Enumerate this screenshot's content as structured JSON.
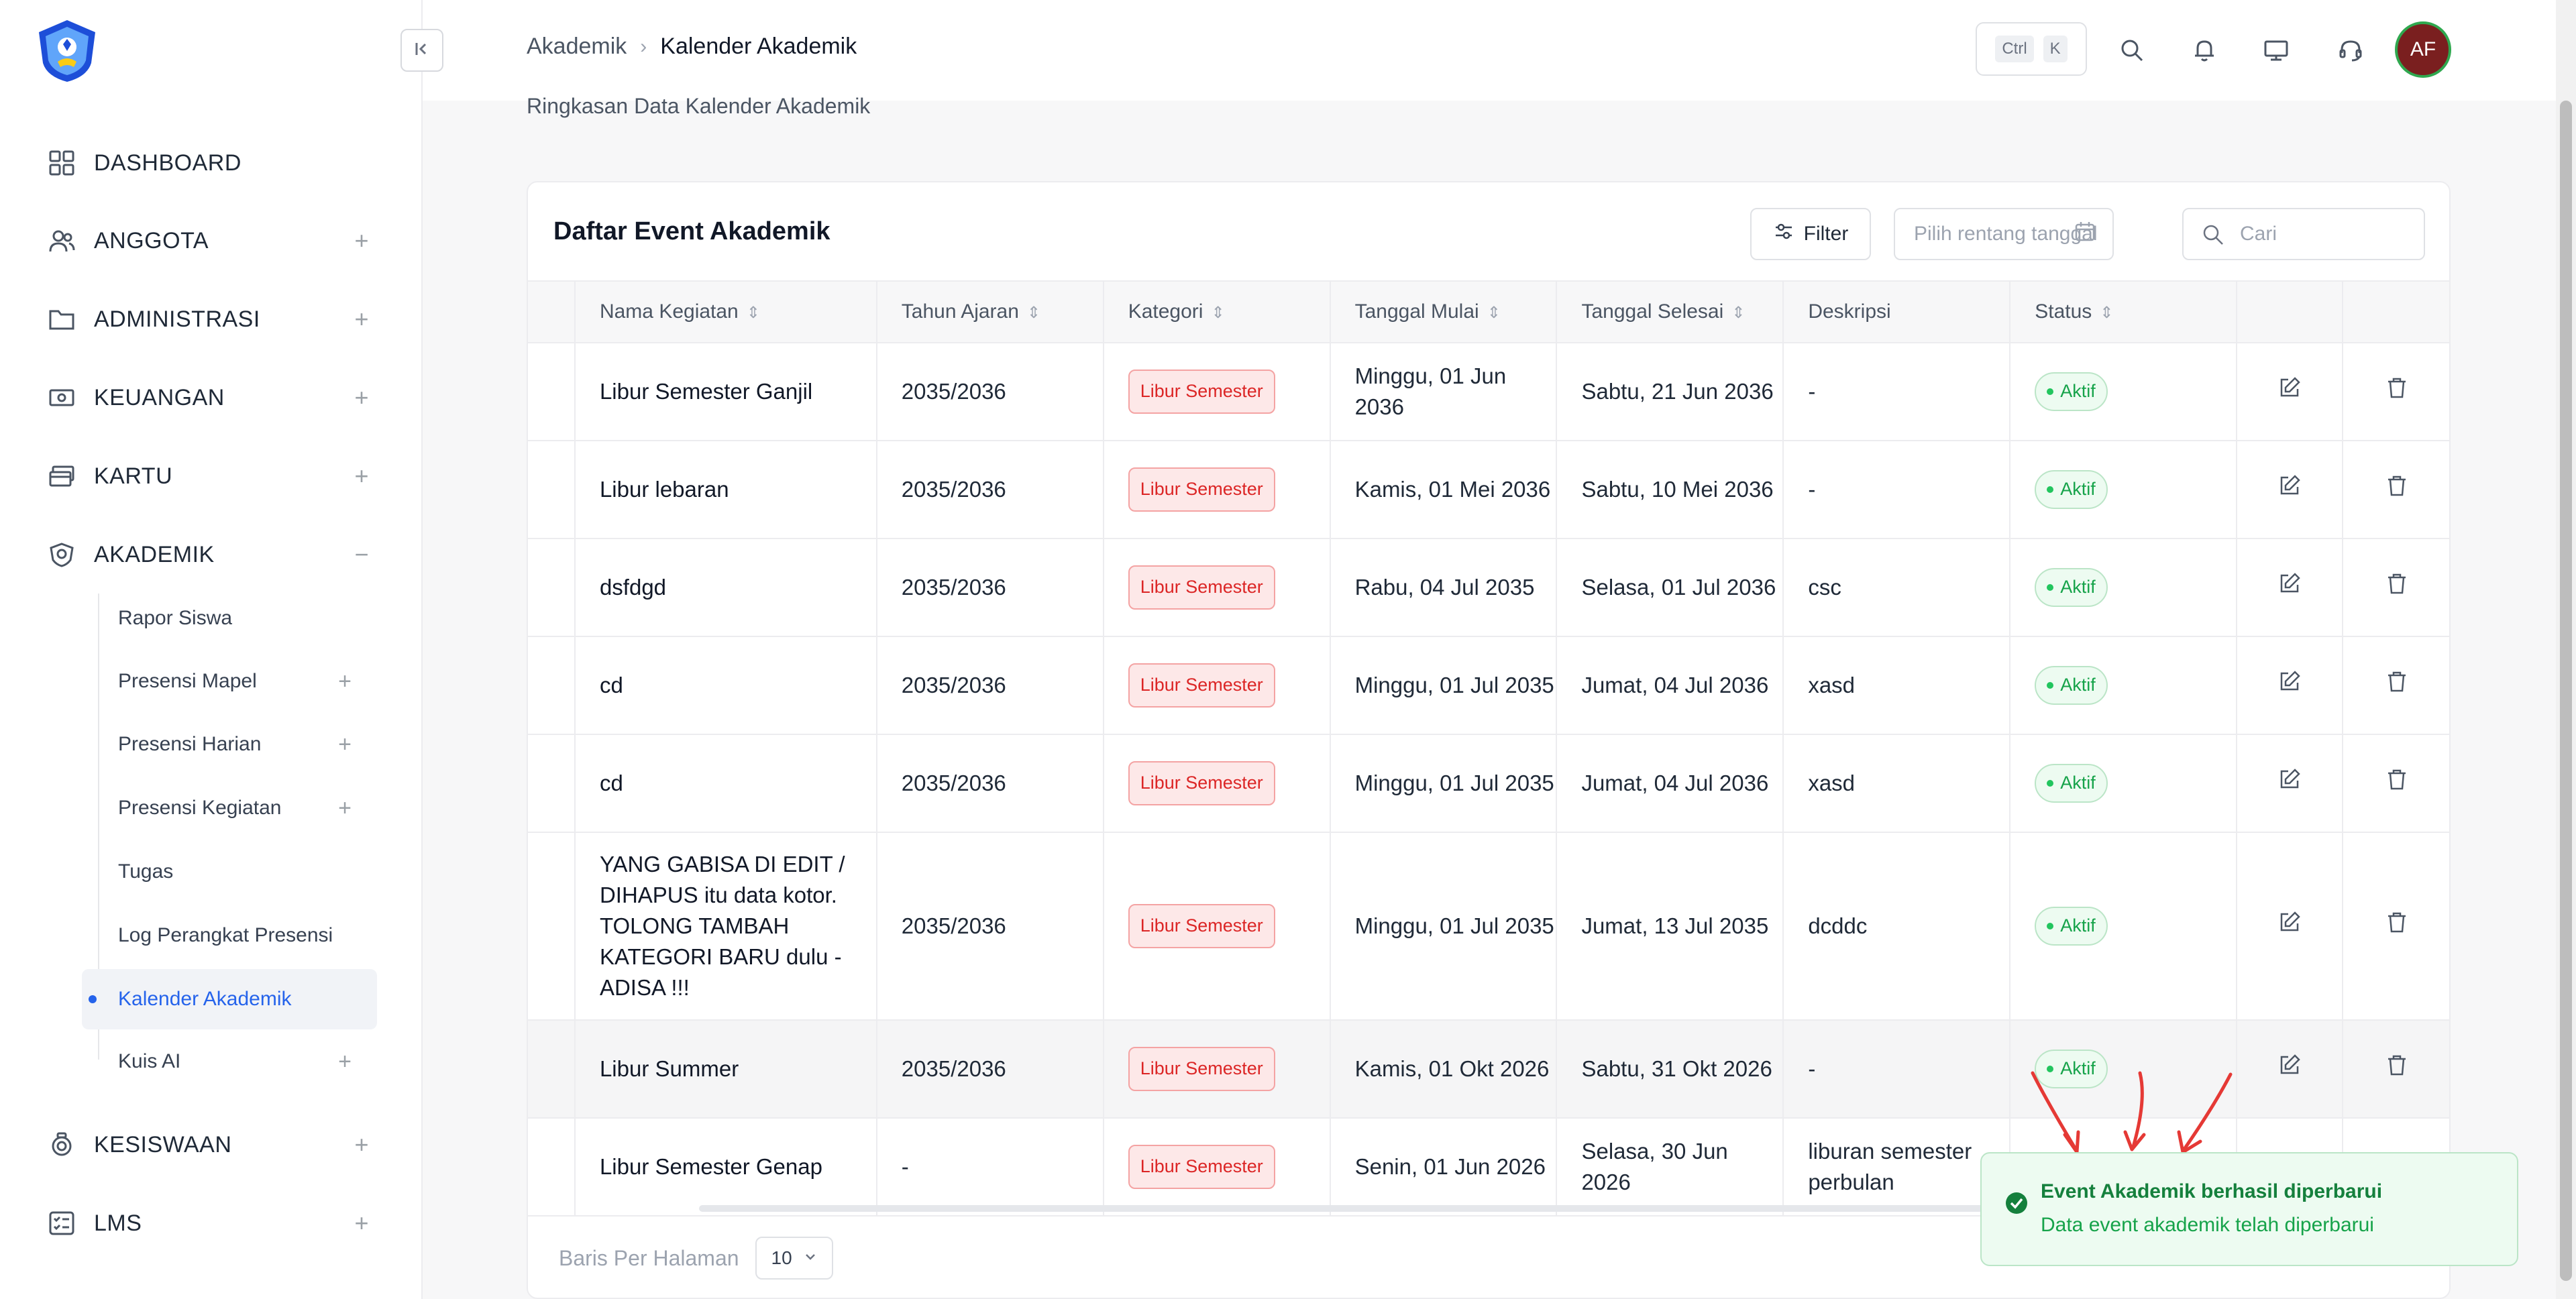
{
  "sidebar": {
    "items": [
      {
        "label": "DASHBOARD",
        "icon": "grid-icon"
      },
      {
        "label": "ANGGOTA",
        "icon": "users-icon",
        "expand": "+"
      },
      {
        "label": "ADMINISTRASI",
        "icon": "folder-icon",
        "expand": "+"
      },
      {
        "label": "KEUANGAN",
        "icon": "money-icon",
        "expand": "+"
      },
      {
        "label": "KARTU",
        "icon": "card-icon",
        "expand": "+"
      },
      {
        "label": "AKADEMIK",
        "icon": "academic-icon",
        "expand": "−"
      },
      {
        "label": "KESISWAAN",
        "icon": "student-icon",
        "expand": "+"
      },
      {
        "label": "LMS",
        "icon": "list-icon",
        "expand": "+"
      }
    ],
    "sub_items": [
      {
        "label": "Rapor Siswa"
      },
      {
        "label": "Presensi Mapel",
        "expand": "+"
      },
      {
        "label": "Presensi Harian",
        "expand": "+"
      },
      {
        "label": "Presensi Kegiatan",
        "expand": "+"
      },
      {
        "label": "Tugas"
      },
      {
        "label": "Log Perangkat Presensi"
      },
      {
        "label": "Kalender Akademik"
      },
      {
        "label": "Kuis AI",
        "expand": "+"
      }
    ]
  },
  "header": {
    "breadcrumb": [
      "Akademik",
      "Kalender Akademik"
    ],
    "shortcut": [
      "Ctrl",
      "K"
    ],
    "avatar": "AF"
  },
  "page": {
    "subtitle": "Ringkasan Data Kalender Akademik"
  },
  "card": {
    "title": "Daftar Event Akademik",
    "filter_label": "Filter",
    "date_placeholder": "Pilih rentang tanggal",
    "search_placeholder": "Cari"
  },
  "table": {
    "columns": [
      "Nama Kegiatan",
      "Tahun Ajaran",
      "Kategori",
      "Tanggal Mulai",
      "Tanggal Selesai",
      "Deskripsi",
      "Status"
    ],
    "rows": [
      {
        "name": "Libur Semester Ganjil",
        "year": "2035/2036",
        "category": "Libur Semester",
        "start": "Minggu, 01 Jun 2036",
        "end": "Sabtu, 21 Jun 2036",
        "desc": "-",
        "status": "Aktif"
      },
      {
        "name": "Libur lebaran",
        "year": "2035/2036",
        "category": "Libur Semester",
        "start": "Kamis, 01 Mei 2036",
        "end": "Sabtu, 10 Mei 2036",
        "desc": "-",
        "status": "Aktif"
      },
      {
        "name": "dsfdgd",
        "year": "2035/2036",
        "category": "Libur Semester",
        "start": "Rabu, 04 Jul 2035",
        "end": "Selasa, 01 Jul 2036",
        "desc": "csc",
        "status": "Aktif"
      },
      {
        "name": "cd",
        "year": "2035/2036",
        "category": "Libur Semester",
        "start": "Minggu, 01 Jul 2035",
        "end": "Jumat, 04 Jul 2036",
        "desc": "xasd",
        "status": "Aktif"
      },
      {
        "name": "cd",
        "year": "2035/2036",
        "category": "Libur Semester",
        "start": "Minggu, 01 Jul 2035",
        "end": "Jumat, 04 Jul 2036",
        "desc": "xasd",
        "status": "Aktif"
      },
      {
        "name": "YANG GABISA DI EDIT / DIHAPUS itu data kotor. TOLONG TAMBAH KATEGORI BARU dulu - ADISA !!!",
        "year": "2035/2036",
        "category": "Libur Semester",
        "start": "Minggu, 01 Jul 2035",
        "end": "Jumat, 13 Jul 2035",
        "desc": "dcddc",
        "status": "Aktif"
      },
      {
        "name": "Libur Summer",
        "year": "2035/2036",
        "category": "Libur Semester",
        "start": "Kamis, 01 Okt 2026",
        "end": "Sabtu, 31 Okt 2026",
        "desc": "-",
        "status": "Aktif"
      },
      {
        "name": "Libur Semester Genap",
        "year": "-",
        "category": "Libur Semester",
        "start": "Senin, 01 Jun 2026",
        "end": "Selasa, 30 Jun 2026",
        "desc": "liburan semester perbulan",
        "status": ""
      }
    ]
  },
  "footer": {
    "rows_label": "Baris Per Halaman",
    "rows_value": "10"
  },
  "toast": {
    "title": "Event Akademik berhasil diperbarui",
    "message": "Data event akademik telah diperbarui"
  },
  "colors": {
    "accent": "#2563eb",
    "danger": "#dc2626",
    "success": "#16a34a",
    "annotation": "#e53935"
  }
}
